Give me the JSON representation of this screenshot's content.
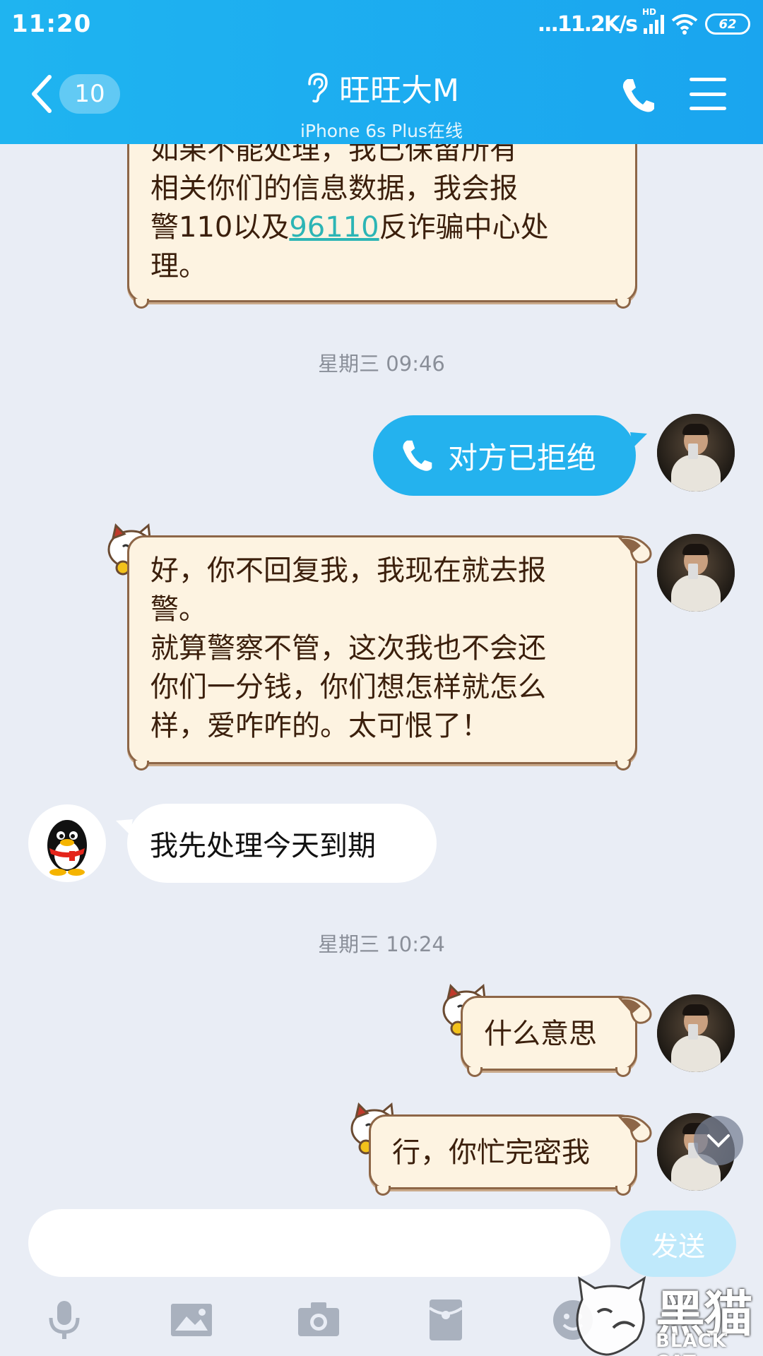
{
  "status_bar": {
    "time": "11:20",
    "network_speed": "...11.2K/s",
    "network_type": "HD",
    "battery": "62"
  },
  "header": {
    "unread_count": "10",
    "title": "旺旺大M",
    "subtitle": "iPhone 6s Plus在线"
  },
  "messages": {
    "msg1_lines": [
      "如果不能处理，我已保留所有",
      "相关你们的信息数据，我会报",
      "警110以及",
      "96110",
      "反诈骗中心处",
      "理。"
    ],
    "time1": "星期三 09:46",
    "call_status": "对方已拒绝",
    "msg2_lines": [
      "好，你不回复我，我现在就去报",
      "警。",
      "就算警察不管，这次我也不会还",
      "你们一分钱，你们想怎样就怎么",
      "样，爱咋咋的。太可恨了！"
    ],
    "msg3": "我先处理今天到期",
    "time2": "星期三 10:24",
    "msg4": "什么意思",
    "msg5": "行，你忙完密我"
  },
  "input": {
    "value": "",
    "send_label": "发送"
  },
  "watermark": {
    "cn": "黑猫",
    "en": "BLACK CAT"
  },
  "colors": {
    "header": "#1fb4f0",
    "background": "#e9edf5",
    "cat_bubble": "#fdf3e1",
    "cat_border": "#8d6647",
    "call_bubble": "#24b2ee",
    "link": "#2cb5b5"
  },
  "icons": [
    "back-chevron-icon",
    "ear-icon",
    "phone-icon",
    "menu-icon",
    "microphone-icon",
    "image-icon",
    "camera-icon",
    "red-packet-icon",
    "emoji-icon",
    "chevron-down-icon"
  ]
}
